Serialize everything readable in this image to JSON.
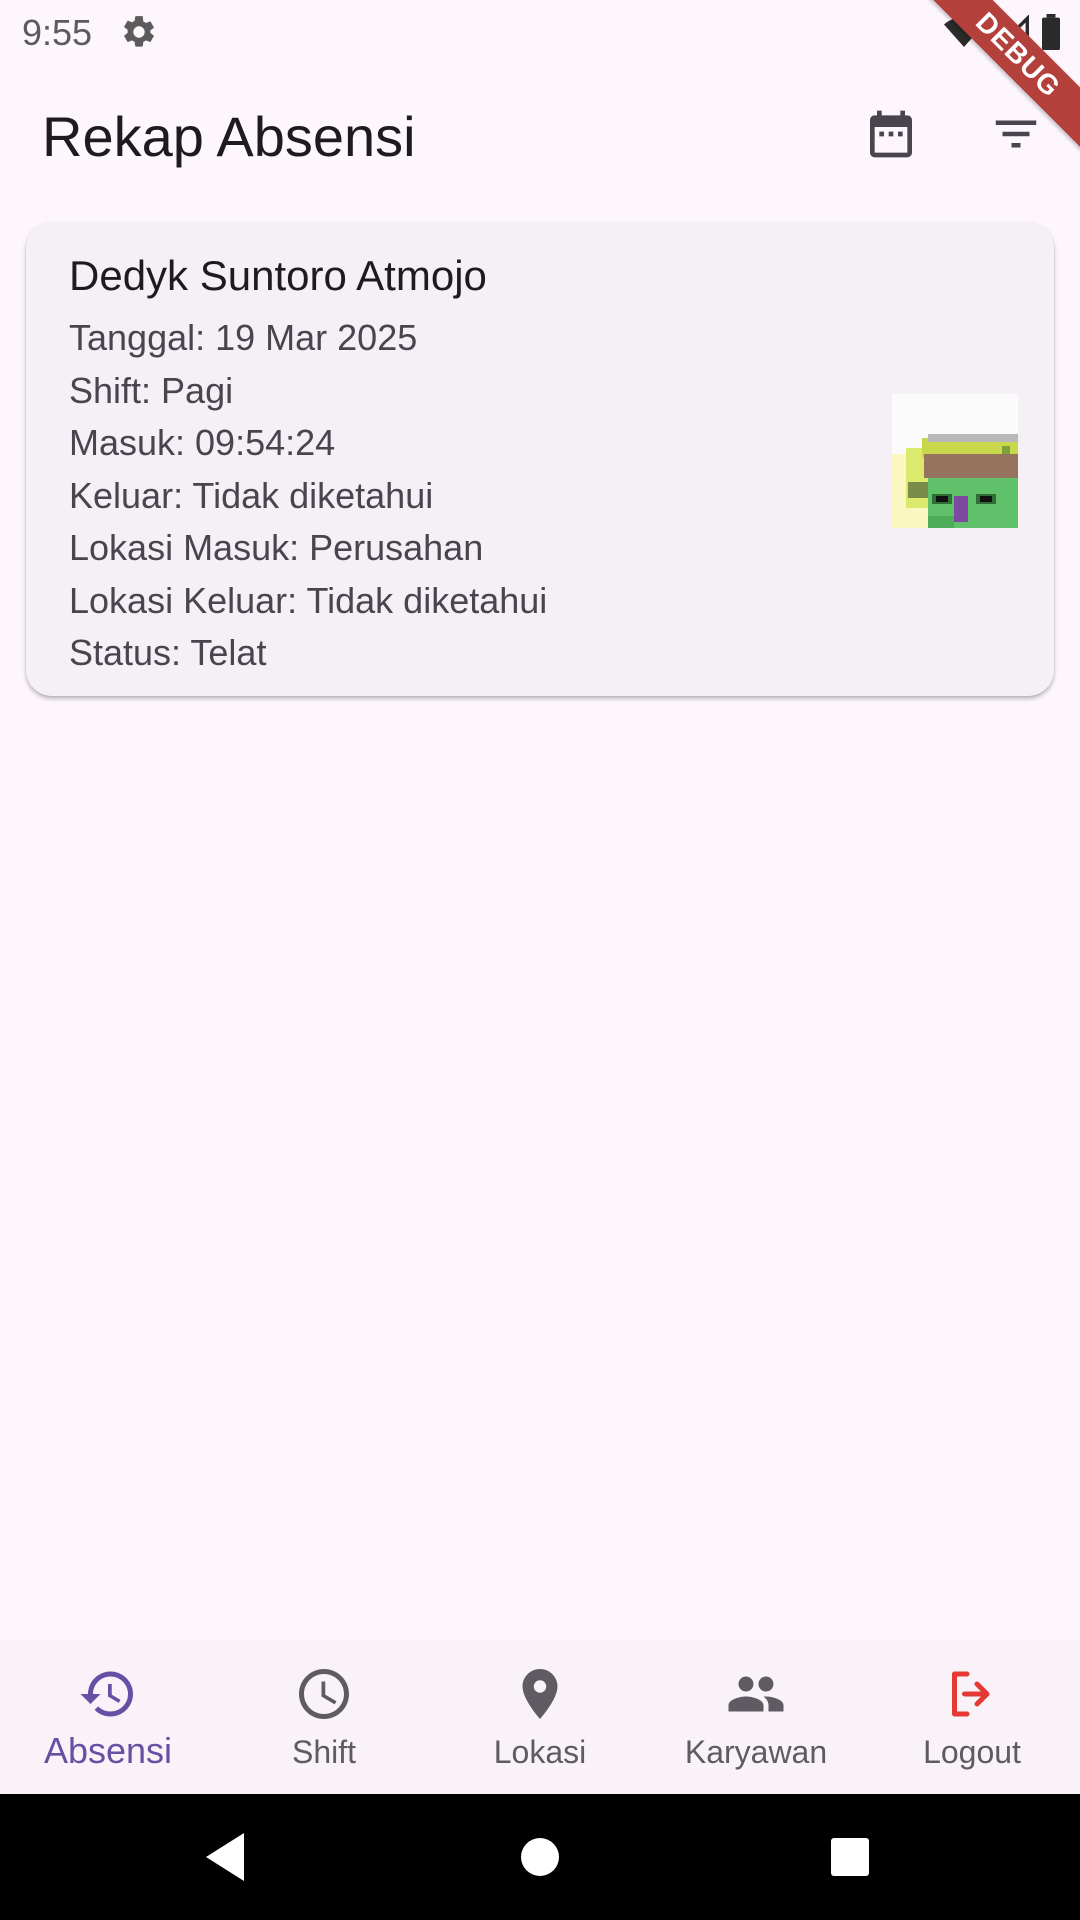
{
  "status_bar": {
    "time": "9:55",
    "icons": [
      "gear-icon",
      "wifi-icon",
      "signal-icon",
      "battery-icon"
    ]
  },
  "debug_banner": {
    "label": "DEBUG"
  },
  "app_bar": {
    "title": "Rekap Absensi",
    "actions": [
      "calendar-icon",
      "filter-icon"
    ]
  },
  "records": [
    {
      "name": "Dedyk Suntoro Atmojo",
      "lines": [
        "Tanggal: 19 Mar 2025",
        "Shift: Pagi",
        "Masuk: 09:54:24",
        "Keluar: Tidak diketahui",
        "Lokasi Masuk: Perusahan",
        "Lokasi Keluar: Tidak diketahui",
        "Status: Telat"
      ]
    }
  ],
  "bottom_nav": {
    "items": [
      {
        "label": "Absensi",
        "icon": "history-icon",
        "active": true
      },
      {
        "label": "Shift",
        "icon": "clock-icon",
        "active": false
      },
      {
        "label": "Lokasi",
        "icon": "location-pin-icon",
        "active": false
      },
      {
        "label": "Karyawan",
        "icon": "people-icon",
        "active": false
      },
      {
        "label": "Logout",
        "icon": "logout-icon",
        "active": false
      }
    ]
  },
  "colors": {
    "background": "#fdf7fd",
    "card": "#f4f0f6",
    "accent": "#6750a4",
    "logout": "#e53935",
    "debug": "#b3403a"
  }
}
